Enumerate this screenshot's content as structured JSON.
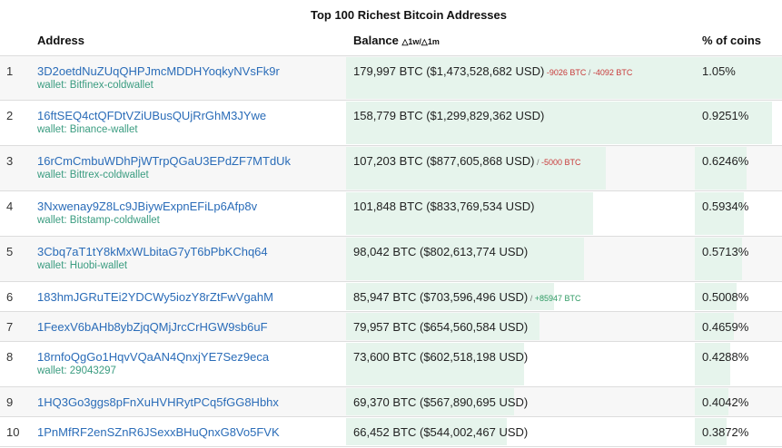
{
  "title": "Top 100 Richest Bitcoin Addresses",
  "headers": {
    "address": "Address",
    "balance": "Balance",
    "deltas": "△1w/△1m",
    "percent": "% of coins"
  },
  "rows": [
    {
      "rank": "1",
      "address": "3D2oetdNuZUqQHPJmcMDDHYoqkyNVsFk9r",
      "wallet": "wallet: Bitfinex-coldwallet",
      "balance": "179,997 BTC ($1,473,528,682 USD)",
      "change_1w": "-9026 BTC",
      "change_1m": "-4092 BTC",
      "change_dir": "neg",
      "percent": "1.05%",
      "bal_level": 1.0,
      "pct_level": 1.0
    },
    {
      "rank": "2",
      "address": "16ftSEQ4ctQFDtVZiUBusQUjRrGhM3JYwe",
      "wallet": "wallet: Binance-wallet",
      "balance": "158,779 BTC ($1,299,829,362 USD)",
      "change_1w": "",
      "change_1m": "",
      "change_dir": "",
      "percent": "0.9251%",
      "bal_level": 0.882,
      "pct_level": 0.881
    },
    {
      "rank": "3",
      "address": "16rCmCmbuWDhPjWTrpQGaU3EPdZF7MTdUk",
      "wallet": "wallet: Bittrex-coldwallet",
      "balance": "107,203 BTC ($877,605,868 USD)",
      "change_1w": "",
      "change_1m": "-5000 BTC",
      "change_dir": "neg",
      "percent": "0.6246%",
      "bal_level": 0.596,
      "pct_level": 0.595
    },
    {
      "rank": "4",
      "address": "3Nxwenay9Z8Lc9JBiywExpnEFiLp6Afp8v",
      "wallet": "wallet: Bitstamp-coldwallet",
      "balance": "101,848 BTC ($833,769,534 USD)",
      "change_1w": "",
      "change_1m": "",
      "change_dir": "",
      "percent": "0.5934%",
      "bal_level": 0.566,
      "pct_level": 0.565
    },
    {
      "rank": "5",
      "address": "3Cbq7aT1tY8kMxWLbitaG7yT6bPbKChq64",
      "wallet": "wallet: Huobi-wallet",
      "balance": "98,042 BTC ($802,613,774 USD)",
      "change_1w": "",
      "change_1m": "",
      "change_dir": "",
      "percent": "0.5713%",
      "bal_level": 0.545,
      "pct_level": 0.544
    },
    {
      "rank": "6",
      "address": "183hmJGRuTEi2YDCWy5iozY8rZtFwVgahM",
      "wallet": "",
      "balance": "85,947 BTC ($703,596,496 USD)",
      "change_1w": "",
      "change_1m": "+85947 BTC",
      "change_dir": "pos",
      "percent": "0.5008%",
      "bal_level": 0.477,
      "pct_level": 0.477
    },
    {
      "rank": "7",
      "address": "1FeexV6bAHb8ybZjqQMjJrcCrHGW9sb6uF",
      "wallet": "",
      "balance": "79,957 BTC ($654,560,584 USD)",
      "change_1w": "",
      "change_1m": "",
      "change_dir": "",
      "percent": "0.4659%",
      "bal_level": 0.444,
      "pct_level": 0.444
    },
    {
      "rank": "8",
      "address": "18rnfoQgGo1HqvVQaAN4QnxjYE7Sez9eca",
      "wallet": "wallet: 29043297",
      "balance": "73,600 BTC ($602,518,198 USD)",
      "change_1w": "",
      "change_1m": "",
      "change_dir": "",
      "percent": "0.4288%",
      "bal_level": 0.409,
      "pct_level": 0.408
    },
    {
      "rank": "9",
      "address": "1HQ3Go3ggs8pFnXuHVHRytPCq5fGG8Hbhx",
      "wallet": "",
      "balance": "69,370 BTC ($567,890,695 USD)",
      "change_1w": "",
      "change_1m": "",
      "change_dir": "",
      "percent": "0.4042%",
      "bal_level": 0.385,
      "pct_level": 0.385
    },
    {
      "rank": "10",
      "address": "1PnMfRF2enSZnR6JSexxBHuQnxG8Vo5FVK",
      "wallet": "",
      "balance": "66,452 BTC ($544,002,467 USD)",
      "change_1w": "",
      "change_1m": "",
      "change_dir": "",
      "percent": "0.3872%",
      "bal_level": 0.369,
      "pct_level": 0.369
    }
  ]
}
